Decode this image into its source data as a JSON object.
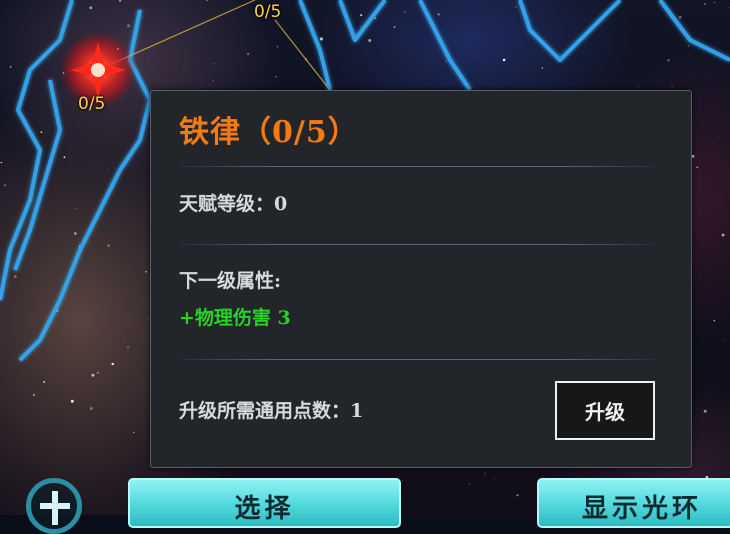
{
  "constellation": {
    "nodes": [
      {
        "label": "0/5"
      },
      {
        "label": "0/5"
      }
    ]
  },
  "tooltip": {
    "title": "铁律（0/5）",
    "talent_level": "天赋等级：0",
    "next_level_header": "下一级属性:",
    "next_level_bonus": "+物理伤害 3",
    "cost_text": "升级所需通用点数：1",
    "upgrade_label": "升级"
  },
  "bottom_bar": {
    "select_label": "选择",
    "show_label": "显示光环"
  },
  "colors": {
    "title": "#f57a12",
    "bonus": "#27d227",
    "node_label": "#ffd24a",
    "button_cyan": "#4fd8dc"
  }
}
